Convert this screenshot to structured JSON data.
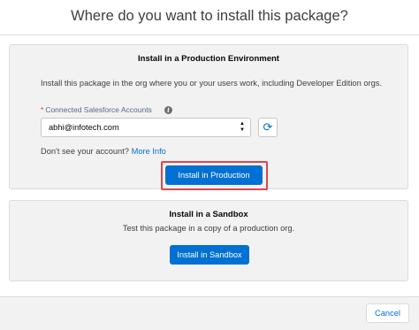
{
  "modal": {
    "title": "Where do you want to install this package?"
  },
  "production": {
    "heading": "Install in a Production Environment",
    "description": "Install this package in the org where you or your users work, including Developer Edition orgs.",
    "accounts_label": "Connected Salesforce Accounts",
    "required_marker": "*",
    "selected_account": "abhi@infotech.com",
    "no_account_text": "Don't see your account?",
    "more_info_link": "More Info",
    "install_button": "Install in Production",
    "highlight_color": "#e0454a"
  },
  "sandbox": {
    "heading": "Install in a Sandbox",
    "description": "Test this package in a copy of a production org.",
    "install_button": "Install in Sandbox"
  },
  "footer": {
    "cancel_button": "Cancel"
  },
  "icons": {
    "info": "info-icon",
    "refresh": "refresh-icon",
    "select_arrows": "select-arrows-icon"
  },
  "colors": {
    "brand": "#0070d2",
    "card_background": "#f3f2f2",
    "border": "#dddbda"
  }
}
